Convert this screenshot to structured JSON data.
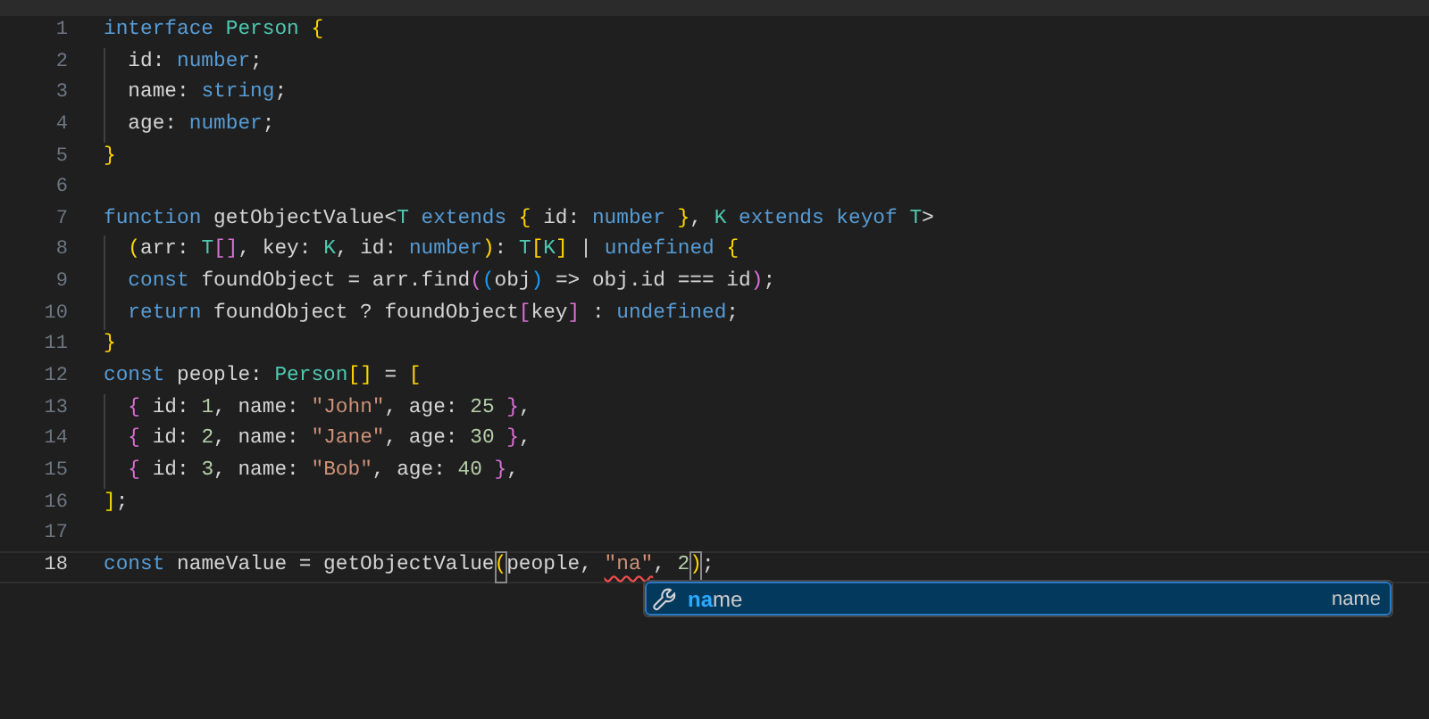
{
  "editor": {
    "lines": [
      {
        "number": "1",
        "current": false,
        "tokens": [
          {
            "text": "interface",
            "kind": "kw"
          },
          {
            "text": " Person",
            "kind": "type"
          },
          {
            "text": " {",
            "kind": "br1"
          }
        ]
      },
      {
        "number": "2",
        "current": false,
        "indent_guide": true,
        "tokens": [
          {
            "text": "  id: ",
            "kind": "plain"
          },
          {
            "text": "number",
            "kind": "kw"
          },
          {
            "text": ";",
            "kind": "plain"
          }
        ]
      },
      {
        "number": "3",
        "current": false,
        "indent_guide": true,
        "tokens": [
          {
            "text": "  name: ",
            "kind": "plain"
          },
          {
            "text": "string",
            "kind": "kw"
          },
          {
            "text": ";",
            "kind": "plain"
          }
        ]
      },
      {
        "number": "4",
        "current": false,
        "indent_guide": true,
        "tokens": [
          {
            "text": "  age: ",
            "kind": "plain"
          },
          {
            "text": "number",
            "kind": "kw"
          },
          {
            "text": ";",
            "kind": "plain"
          }
        ]
      },
      {
        "number": "5",
        "current": false,
        "tokens": [
          {
            "text": "}",
            "kind": "br1"
          }
        ]
      },
      {
        "number": "6",
        "current": false
      },
      {
        "number": "7",
        "current": false,
        "tokens": [
          {
            "text": "function",
            "kind": "kw"
          },
          {
            "text": " getObjectValue<",
            "kind": "plain"
          },
          {
            "text": "T",
            "kind": "type"
          },
          {
            "text": " extends",
            "kind": "kw"
          },
          {
            "text": " {",
            "kind": "br1"
          },
          {
            "text": " id: ",
            "kind": "plain"
          },
          {
            "text": "number",
            "kind": "kw"
          },
          {
            "text": " }",
            "kind": "br1"
          },
          {
            "text": ", ",
            "kind": "plain"
          },
          {
            "text": "K",
            "kind": "type"
          },
          {
            "text": " extends",
            "kind": "kw"
          },
          {
            "text": " keyof",
            "kind": "kw"
          },
          {
            "text": " T",
            "kind": "type"
          },
          {
            "text": ">",
            "kind": "plain"
          }
        ]
      },
      {
        "number": "8",
        "current": false,
        "indent_guide": true,
        "tokens": [
          {
            "text": "  (",
            "kind": "br1"
          },
          {
            "text": "arr: ",
            "kind": "plain"
          },
          {
            "text": "T",
            "kind": "type"
          },
          {
            "text": "[]",
            "kind": "br2"
          },
          {
            "text": ", key: ",
            "kind": "plain"
          },
          {
            "text": "K",
            "kind": "type"
          },
          {
            "text": ", id: ",
            "kind": "plain"
          },
          {
            "text": "number",
            "kind": "kw"
          },
          {
            "text": ")",
            "kind": "br1"
          },
          {
            "text": ": ",
            "kind": "plain"
          },
          {
            "text": "T",
            "kind": "type"
          },
          {
            "text": "[",
            "kind": "br1"
          },
          {
            "text": "K",
            "kind": "type"
          },
          {
            "text": "]",
            "kind": "br1"
          },
          {
            "text": " | ",
            "kind": "plain"
          },
          {
            "text": "undefined",
            "kind": "kw"
          },
          {
            "text": " {",
            "kind": "br1"
          }
        ]
      },
      {
        "number": "9",
        "current": false,
        "indent_guide": true,
        "tokens": [
          {
            "text": "  const",
            "kind": "kw"
          },
          {
            "text": " foundObject = arr.find",
            "kind": "plain"
          },
          {
            "text": "(",
            "kind": "br2"
          },
          {
            "text": "(",
            "kind": "br3"
          },
          {
            "text": "obj",
            "kind": "plain"
          },
          {
            "text": ")",
            "kind": "br3"
          },
          {
            "text": " => obj.id === id",
            "kind": "plain"
          },
          {
            "text": ")",
            "kind": "br2"
          },
          {
            "text": ";",
            "kind": "plain"
          }
        ]
      },
      {
        "number": "10",
        "current": false,
        "indent_guide": true,
        "tokens": [
          {
            "text": "  return",
            "kind": "kw"
          },
          {
            "text": " foundObject ? foundObject",
            "kind": "plain"
          },
          {
            "text": "[",
            "kind": "br2"
          },
          {
            "text": "key",
            "kind": "plain"
          },
          {
            "text": "]",
            "kind": "br2"
          },
          {
            "text": " : ",
            "kind": "plain"
          },
          {
            "text": "undefined",
            "kind": "kw"
          },
          {
            "text": ";",
            "kind": "plain"
          }
        ]
      },
      {
        "number": "11",
        "current": false,
        "tokens": [
          {
            "text": "}",
            "kind": "br1"
          }
        ]
      },
      {
        "number": "12",
        "current": false,
        "tokens": [
          {
            "text": "const",
            "kind": "kw"
          },
          {
            "text": " people: ",
            "kind": "plain"
          },
          {
            "text": "Person",
            "kind": "type"
          },
          {
            "text": "[]",
            "kind": "br1"
          },
          {
            "text": " = ",
            "kind": "plain"
          },
          {
            "text": "[",
            "kind": "br1"
          }
        ]
      },
      {
        "number": "13",
        "current": false,
        "indent_guide": true,
        "tokens": [
          {
            "text": "  {",
            "kind": "br2"
          },
          {
            "text": " id: ",
            "kind": "plain"
          },
          {
            "text": "1",
            "kind": "num"
          },
          {
            "text": ", name: ",
            "kind": "plain"
          },
          {
            "text": "\"John\"",
            "kind": "str"
          },
          {
            "text": ", age: ",
            "kind": "plain"
          },
          {
            "text": "25",
            "kind": "num"
          },
          {
            "text": " }",
            "kind": "br2"
          },
          {
            "text": ",",
            "kind": "plain"
          }
        ]
      },
      {
        "number": "14",
        "current": false,
        "indent_guide": true,
        "tokens": [
          {
            "text": "  {",
            "kind": "br2"
          },
          {
            "text": " id: ",
            "kind": "plain"
          },
          {
            "text": "2",
            "kind": "num"
          },
          {
            "text": ", name: ",
            "kind": "plain"
          },
          {
            "text": "\"Jane\"",
            "kind": "str"
          },
          {
            "text": ", age: ",
            "kind": "plain"
          },
          {
            "text": "30",
            "kind": "num"
          },
          {
            "text": " }",
            "kind": "br2"
          },
          {
            "text": ",",
            "kind": "plain"
          }
        ]
      },
      {
        "number": "15",
        "current": false,
        "indent_guide": true,
        "tokens": [
          {
            "text": "  {",
            "kind": "br2"
          },
          {
            "text": " id: ",
            "kind": "plain"
          },
          {
            "text": "3",
            "kind": "num"
          },
          {
            "text": ", name: ",
            "kind": "plain"
          },
          {
            "text": "\"Bob\"",
            "kind": "str"
          },
          {
            "text": ", age: ",
            "kind": "plain"
          },
          {
            "text": "40",
            "kind": "num"
          },
          {
            "text": " }",
            "kind": "br2"
          },
          {
            "text": ",",
            "kind": "plain"
          }
        ]
      },
      {
        "number": "16",
        "current": false,
        "tokens": [
          {
            "text": "]",
            "kind": "br1"
          },
          {
            "text": ";",
            "kind": "plain"
          }
        ]
      },
      {
        "number": "17",
        "current": false
      },
      {
        "number": "18",
        "current": true,
        "tokens": [
          {
            "text": "const",
            "kind": "kw"
          },
          {
            "text": " nameValue = getObjectValue",
            "kind": "plain"
          },
          {
            "text": "(",
            "kind": "match"
          },
          {
            "text": "people, ",
            "kind": "plain"
          },
          {
            "text": "\"na\"",
            "kind": "error"
          },
          {
            "text": ", ",
            "kind": "plain"
          },
          {
            "text": "2",
            "kind": "num"
          },
          {
            "text": ")",
            "kind": "match"
          },
          {
            "text": ";",
            "kind": "plain"
          }
        ]
      }
    ]
  },
  "suggest": {
    "items": [
      {
        "match": "na",
        "rest": "me",
        "detail": "name",
        "selected": true
      }
    ]
  }
}
